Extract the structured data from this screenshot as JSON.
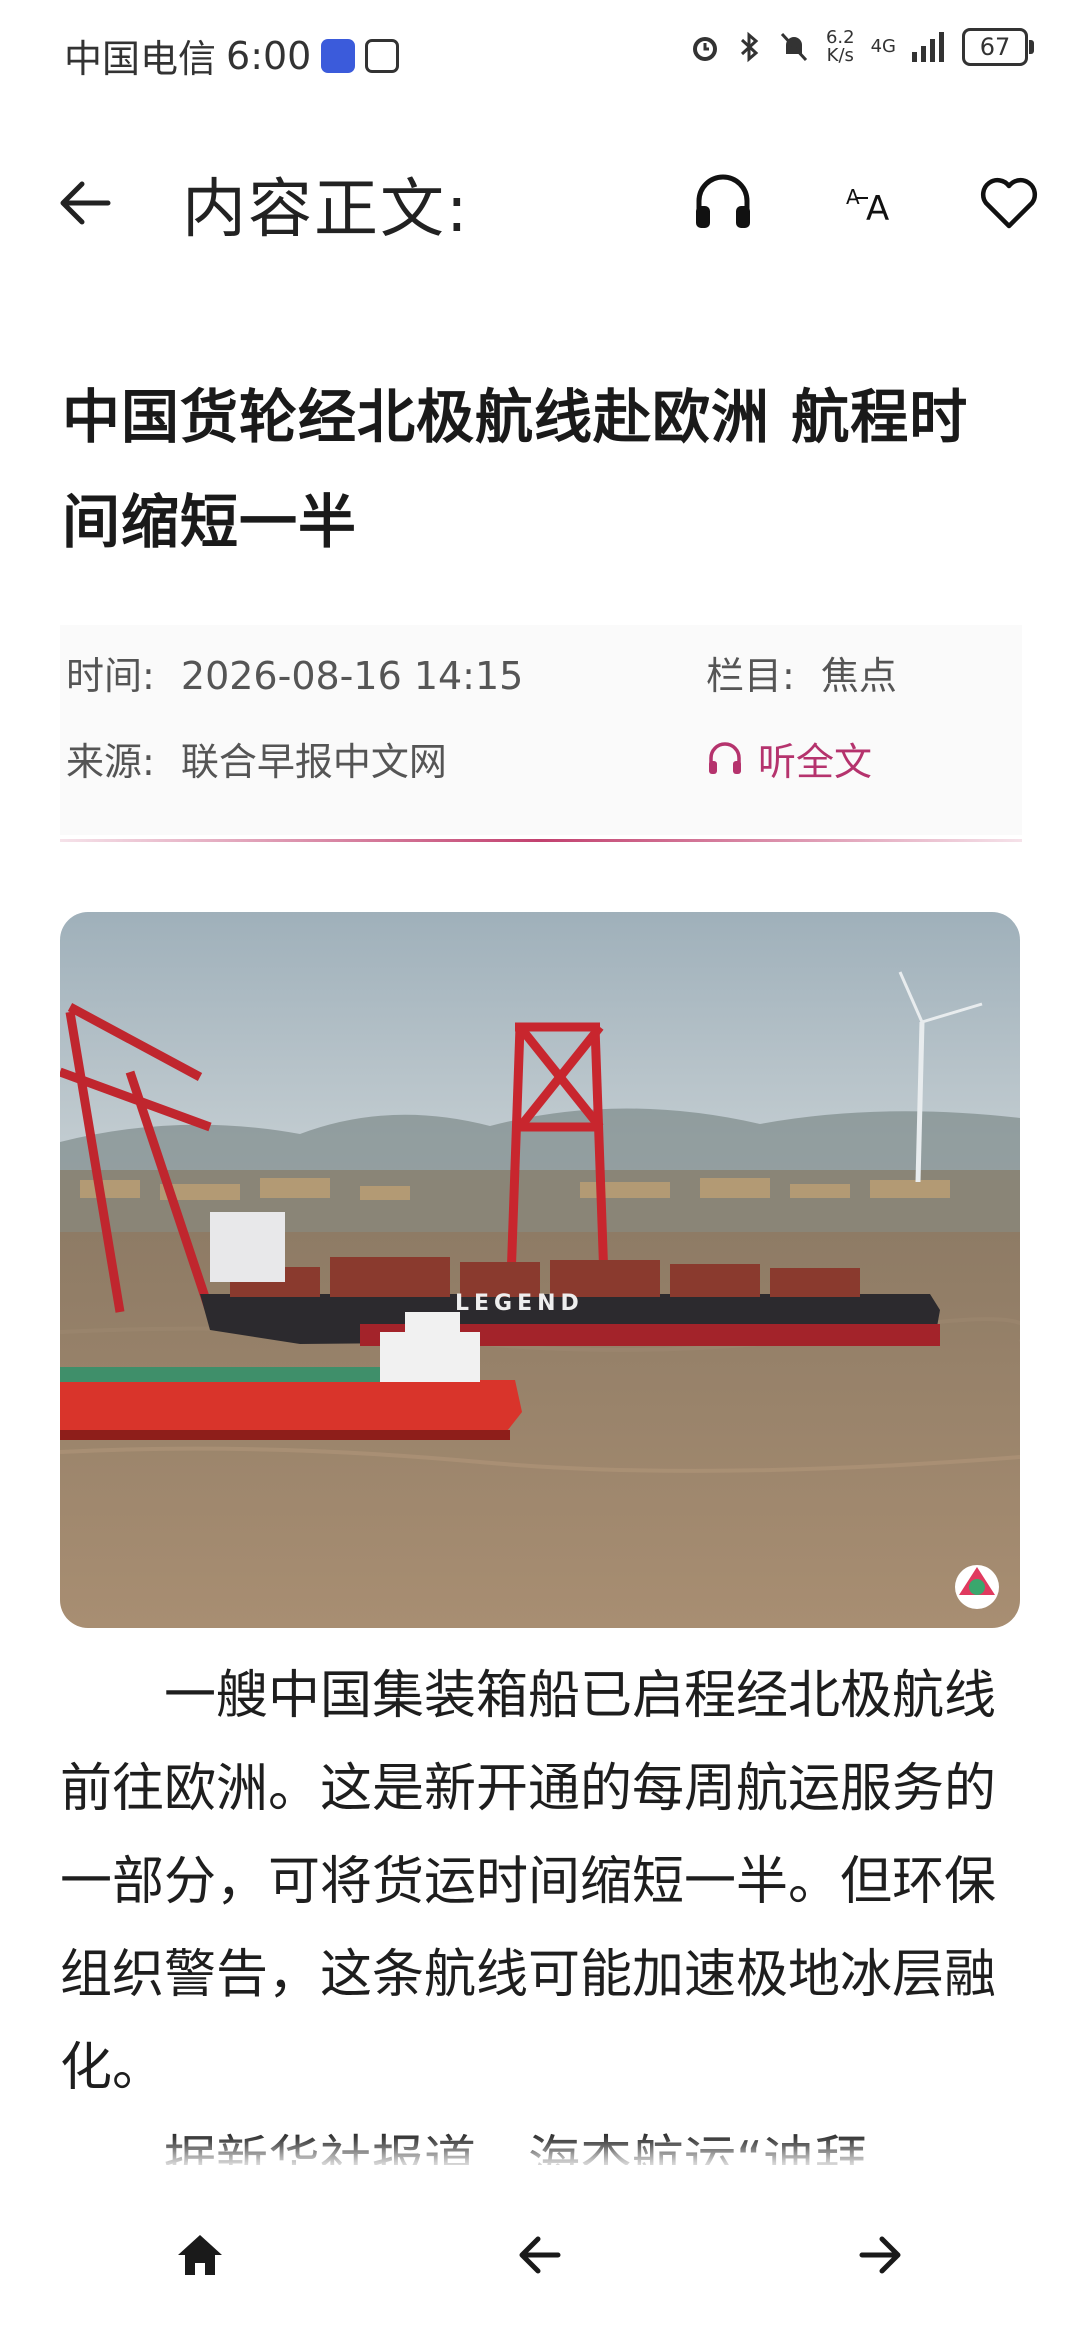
{
  "status_bar": {
    "carrier": "中国电信",
    "time": "6:00",
    "speed_value": "6.2",
    "speed_unit": "K/s",
    "network": "4G",
    "battery": "67"
  },
  "header": {
    "title": "内容正文:"
  },
  "article": {
    "title": "中国货轮经北极航线赴欧洲 航程时间缩短一半",
    "time_label": "时间:",
    "time_value": "2026-08-16 14:15",
    "column_label": "栏目:",
    "column_value": "焦点",
    "source_label": "来源:",
    "source_value": "联合早报中文网",
    "listen_label": "听全文",
    "paragraphs": [
      "一艘中国集装箱船已启程经北极航线前往欧洲。这是新开通的每周航运服务的一部分，可将货运时间缩短一半。但环保组织警告，这条航线可能加速极地冰层融化。",
      "据新华社报道，海杰航运“迪拜"
    ],
    "image": {
      "ship_hull_text": "LEGEND"
    }
  },
  "colors": {
    "accent": "#b5336d",
    "text": "#1a1a1a"
  },
  "icons": [
    "back-arrow-icon",
    "headphones-icon",
    "font-size-icon",
    "heart-icon",
    "home-icon",
    "prev-arrow-icon",
    "next-arrow-icon"
  ]
}
